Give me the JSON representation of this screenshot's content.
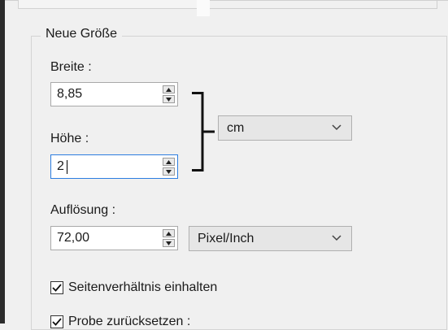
{
  "group": {
    "title": "Neue Größe"
  },
  "width": {
    "label": "Breite :",
    "value": "8,85"
  },
  "height": {
    "label": "Höhe :",
    "value": "2"
  },
  "unit_select": {
    "value": "cm"
  },
  "resolution": {
    "label": "Auflösung :",
    "value": "72,00",
    "unit": "Pixel/Inch"
  },
  "options": {
    "keep_ratio": {
      "label": "Seitenverhältnis einhalten",
      "checked": true
    },
    "resample": {
      "label": "Probe zurücksetzen :",
      "checked": true
    }
  },
  "icons": {
    "spin_up": "arrow-up-icon",
    "spin_down": "arrow-down-icon",
    "dropdown": "chevron-down-icon",
    "check": "checkmark-icon",
    "link": "link-bracket-icon"
  }
}
